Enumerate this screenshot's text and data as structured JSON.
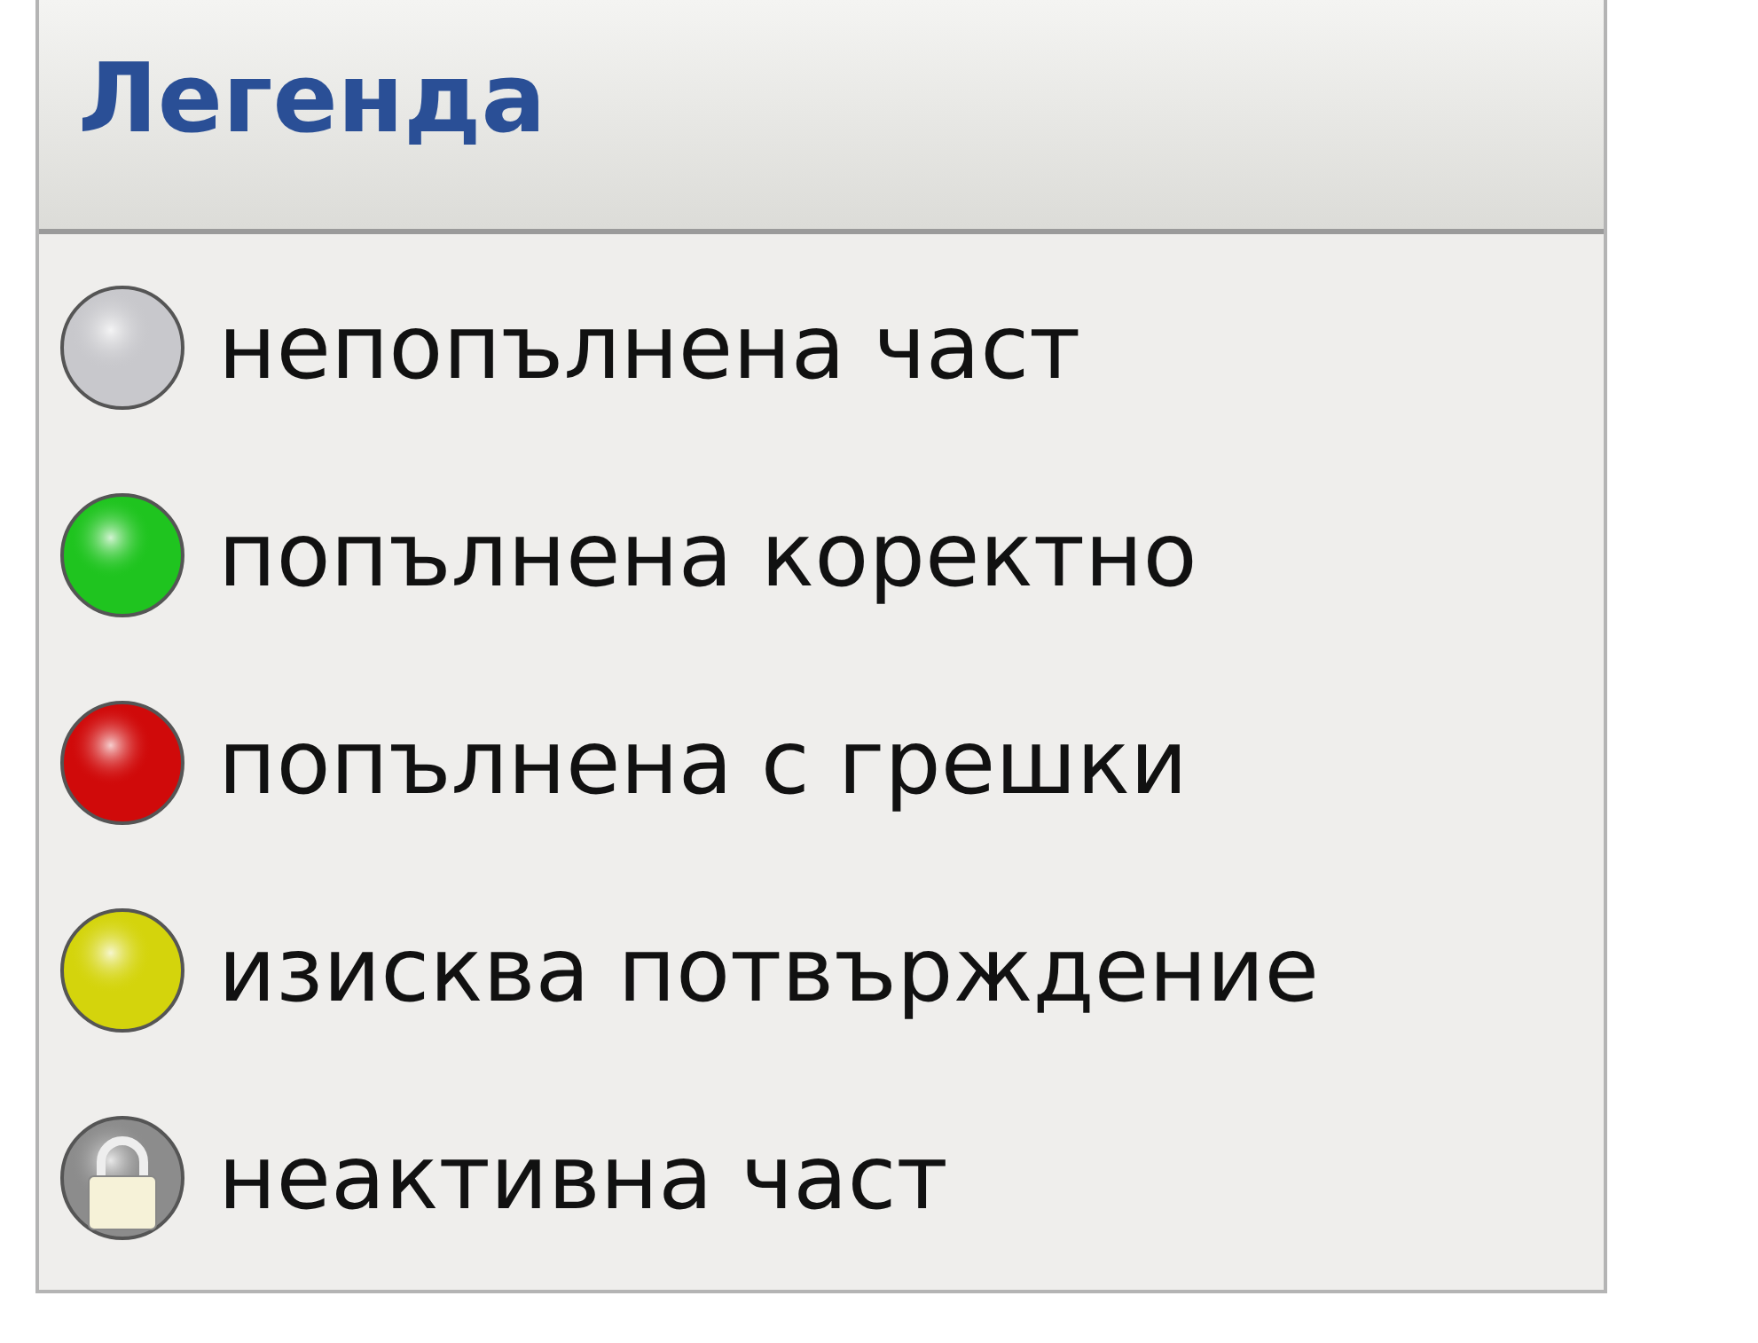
{
  "legend": {
    "title": "Легенда",
    "items": [
      {
        "label": "непопълнена част",
        "color": "#c8c8cc",
        "kind": "dot"
      },
      {
        "label": "попълнена коректно",
        "color": "#1fc41f",
        "kind": "dot"
      },
      {
        "label": "попълнена с грешки",
        "color": "#d00a0a",
        "kind": "dot"
      },
      {
        "label": "изисква потвърждение",
        "color": "#d4d40c",
        "kind": "dot"
      },
      {
        "label": "неактивна част",
        "color": "#8c8c8c",
        "kind": "lock"
      }
    ]
  }
}
